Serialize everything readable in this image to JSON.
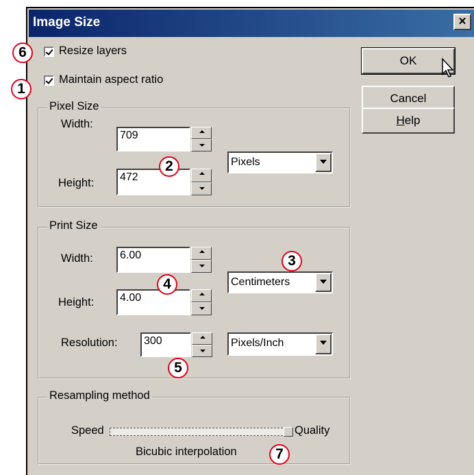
{
  "dialog": {
    "title": "Image Size",
    "close_label": "×"
  },
  "checkboxes": {
    "resize_layers": "Resize layers",
    "maintain_aspect": "Maintain aspect ratio"
  },
  "pixel_size": {
    "legend": "Pixel Size",
    "width_label": "Width:",
    "width_value": "709",
    "height_label": "Height:",
    "height_value": "472",
    "units": "Pixels"
  },
  "print_size": {
    "legend": "Print Size",
    "width_label": "Width:",
    "width_value": "6.00",
    "height_label": "Height:",
    "height_value": "4.00",
    "units": "Centimeters",
    "resolution_label": "Resolution:",
    "resolution_value": "300",
    "resolution_units": "Pixels/Inch"
  },
  "resampling": {
    "legend": "Resampling method",
    "speed_label": "Speed",
    "quality_label": "Quality",
    "method": "Bicubic interpolation",
    "slider_level": 1.0
  },
  "buttons": {
    "ok": "OK",
    "cancel": "Cancel",
    "help_accel": "H",
    "help_rest": "elp"
  },
  "callouts": {
    "c1": "1",
    "c2": "2",
    "c3": "3",
    "c4": "4",
    "c5": "5",
    "c6": "6",
    "c7": "7"
  },
  "colors": {
    "title_bar": "#0a246a",
    "dialog_bg": "#d4d0c8",
    "callout_ring": "#e2001a"
  }
}
